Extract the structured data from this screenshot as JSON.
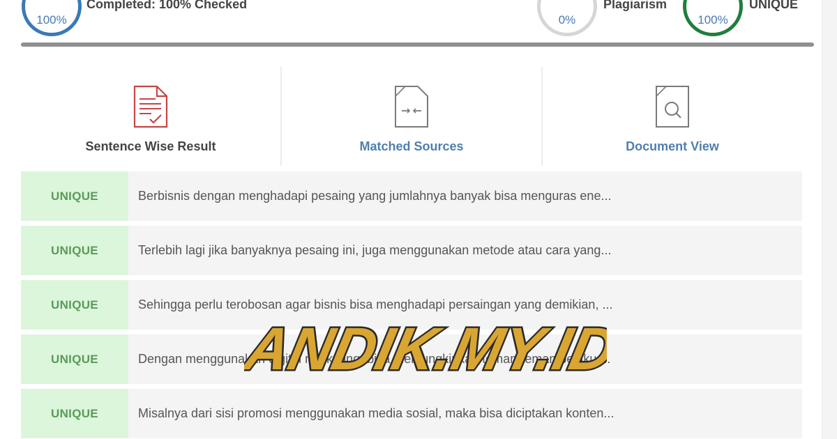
{
  "header": {
    "progress_percent": "100%",
    "status_text": "Completed: 100% Checked",
    "plagiarism_percent": "0%",
    "plagiarism_label": "Plagiarism",
    "unique_percent": "100%",
    "unique_label": "UNIQUE",
    "colors": {
      "progress": "#3b79b8",
      "plagiarism": "#d6d6d6",
      "unique": "#1e7e3e"
    }
  },
  "tabs": [
    {
      "label": "Sentence Wise Result",
      "icon": "document-check-icon",
      "active": true
    },
    {
      "label": "Matched Sources",
      "icon": "document-compare-icon",
      "active": false
    },
    {
      "label": "Document View",
      "icon": "document-search-icon",
      "active": false
    }
  ],
  "results": [
    {
      "status": "UNIQUE",
      "text": "Berbisnis dengan menghadapi pesaing yang jumlahnya banyak bisa menguras ene..."
    },
    {
      "status": "UNIQUE",
      "text": "Terlebih lagi jika banyaknya pesaing ini, juga menggunakan metode atau cara yang..."
    },
    {
      "status": "UNIQUE",
      "text": "Sehingga perlu terobosan agar bisnis bisa menghadapi persaingan yang demikian, ..."
    },
    {
      "status": "UNIQUE",
      "text": "Dengan menggunakan digital marketing, bisa memungkinkan teman-teman pelaku ..."
    },
    {
      "status": "UNIQUE",
      "text": "Misalnya dari sisi promosi menggunakan media sosial, maka bisa diciptakan konten..."
    }
  ],
  "watermark": {
    "text": "ANDIK.MY.ID"
  }
}
